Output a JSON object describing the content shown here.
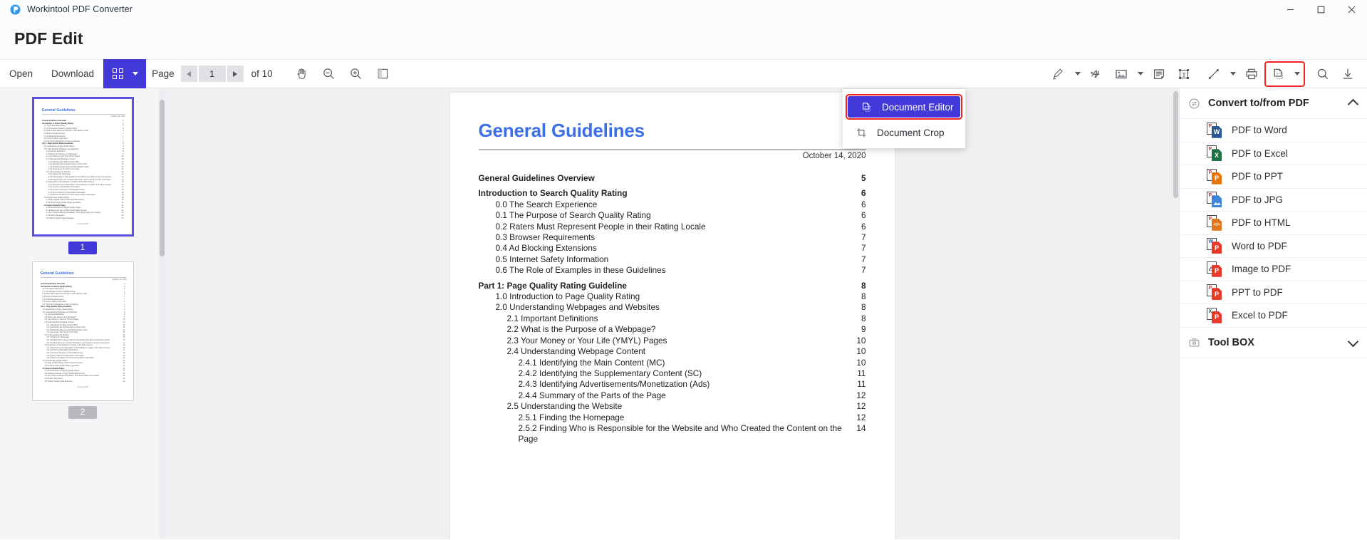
{
  "window": {
    "app_title": "Workintool PDF Converter",
    "logo_icon": "workintool-logo-icon",
    "minimize": "—",
    "maximize": "❐",
    "close": "✕"
  },
  "page_heading": {
    "title": "PDF Edit"
  },
  "toolbar": {
    "open_label": "Open",
    "download_label": "Download",
    "grid_view_icon": "grid-view-icon",
    "page_label": "Page",
    "page_value": "1",
    "page_total": "of 10",
    "prev_page_icon": "chevron-left-icon",
    "next_page_icon": "chevron-right-icon",
    "left_tools": [
      {
        "name": "hand-pan-icon",
        "title": "Pan"
      },
      {
        "name": "zoom-out-icon",
        "title": "Zoom out"
      },
      {
        "name": "zoom-in-icon",
        "title": "Zoom in"
      },
      {
        "name": "page-fit-icon",
        "title": "Page fit"
      }
    ],
    "right_tools": [
      {
        "name": "highlighter-icon",
        "title": "Highlight",
        "caret": true
      },
      {
        "name": "signature-icon",
        "title": "Signature",
        "caret": false
      },
      {
        "name": "insert-image-icon",
        "title": "Insert image",
        "caret": true
      },
      {
        "name": "sticky-note-icon",
        "title": "Note",
        "caret": false
      },
      {
        "name": "text-box-icon",
        "title": "Text box",
        "caret": false
      },
      {
        "name": "line-shape-icon",
        "title": "Line",
        "caret": true
      },
      {
        "name": "print-icon",
        "title": "Print",
        "caret": false
      },
      {
        "name": "document-editor-icon",
        "title": "Document Editor",
        "caret": true,
        "highlighted": true
      },
      {
        "name": "search-icon",
        "title": "Search",
        "caret": false
      },
      {
        "name": "download-icon",
        "title": "Download",
        "caret": false
      }
    ]
  },
  "dropdown": {
    "items": [
      {
        "label": "Document Editor",
        "icon": "document-editor-icon",
        "active": true
      },
      {
        "label": "Document Crop",
        "icon": "document-crop-icon",
        "active": false
      }
    ]
  },
  "thumbnails": [
    {
      "page_number": "1",
      "selected": true
    },
    {
      "page_number": "2",
      "selected": false
    }
  ],
  "right_panel": {
    "sections": [
      {
        "title": "Convert to/from PDF",
        "icon": "convert-circular-icon",
        "expanded": true,
        "chevron": "chevron-up-icon",
        "items": [
          {
            "label": "PDF to Word",
            "from": "P",
            "to": "W",
            "color": "#2b5797"
          },
          {
            "label": "PDF to Excel",
            "from": "P",
            "to": "X",
            "color": "#1e7145"
          },
          {
            "label": "PDF to PPT",
            "from": "P",
            "to": "P",
            "color": "#e8750a"
          },
          {
            "label": "PDF to JPG",
            "from": "P",
            "to": "",
            "color": "#3b84d9"
          },
          {
            "label": "PDF to HTML",
            "from": "P",
            "to": "</>",
            "color": "#e0751a"
          },
          {
            "label": "Word to PDF",
            "from": "W",
            "to": "P",
            "color": "#e8392b"
          },
          {
            "label": "Image to PDF",
            "from": "",
            "to": "P",
            "color": "#e8392b"
          },
          {
            "label": "PPT to PDF",
            "from": "P",
            "to": "P",
            "color": "#e8392b"
          },
          {
            "label": "Excel to PDF",
            "from": "X",
            "to": "P",
            "color": "#e8392b"
          }
        ]
      },
      {
        "title": "Tool BOX",
        "icon": "toolbox-icon",
        "expanded": false,
        "chevron": "chevron-down-icon",
        "items": []
      }
    ]
  },
  "document": {
    "heading": "General Guidelines",
    "date": "October 14, 2020",
    "toc": [
      {
        "text": "General Guidelines Overview",
        "page": "5",
        "bold": true,
        "indent": 0
      },
      {
        "text": "Introduction to Search Quality Rating",
        "page": "6",
        "bold": true,
        "indent": 0
      },
      {
        "text": "0.0 The Search Experience",
        "page": "6",
        "bold": false,
        "indent": 1
      },
      {
        "text": "0.1 The Purpose of Search Quality Rating",
        "page": "6",
        "bold": false,
        "indent": 1
      },
      {
        "text": "0.2 Raters Must Represent People in their Rating Locale",
        "page": "6",
        "bold": false,
        "indent": 1
      },
      {
        "text": "0.3 Browser Requirements",
        "page": "7",
        "bold": false,
        "indent": 1
      },
      {
        "text": "0.4 Ad Blocking Extensions",
        "page": "7",
        "bold": false,
        "indent": 1
      },
      {
        "text": "0.5 Internet Safety Information",
        "page": "7",
        "bold": false,
        "indent": 1
      },
      {
        "text": "0.6 The Role of Examples in these Guidelines",
        "page": "7",
        "bold": false,
        "indent": 1
      },
      {
        "text": "Part 1: Page Quality Rating Guideline",
        "page": "8",
        "bold": true,
        "indent": 0
      },
      {
        "text": "1.0 Introduction to Page Quality Rating",
        "page": "8",
        "bold": false,
        "indent": 1
      },
      {
        "text": "2.0 Understanding Webpages and Websites",
        "page": "8",
        "bold": false,
        "indent": 1
      },
      {
        "text": "2.1 Important Definitions",
        "page": "8",
        "bold": false,
        "indent": 2
      },
      {
        "text": "2.2 What is the Purpose of a Webpage?",
        "page": "9",
        "bold": false,
        "indent": 2
      },
      {
        "text": "2.3 Your Money or Your Life (YMYL) Pages",
        "page": "10",
        "bold": false,
        "indent": 2
      },
      {
        "text": "2.4 Understanding Webpage Content",
        "page": "10",
        "bold": false,
        "indent": 2
      },
      {
        "text": "2.4.1 Identifying the Main Content (MC)",
        "page": "10",
        "bold": false,
        "indent": 3
      },
      {
        "text": "2.4.2 Identifying the Supplementary Content (SC)",
        "page": "11",
        "bold": false,
        "indent": 3
      },
      {
        "text": "2.4.3 Identifying Advertisements/Monetization (Ads)",
        "page": "11",
        "bold": false,
        "indent": 3
      },
      {
        "text": "2.4.4 Summary of the Parts of the Page",
        "page": "12",
        "bold": false,
        "indent": 3
      },
      {
        "text": "2.5 Understanding the Website",
        "page": "12",
        "bold": false,
        "indent": 2
      },
      {
        "text": "2.5.1 Finding the Homepage",
        "page": "12",
        "bold": false,
        "indent": 3
      },
      {
        "text": "2.5.2 Finding Who is Responsible for the Website and Who Created the Content on the Page",
        "page": "14",
        "bold": false,
        "indent": 3
      }
    ],
    "thumb_toc_rows": [
      {
        "t": "General Guidelines Overview",
        "n": "5",
        "b": true,
        "i": 0
      },
      {
        "t": "Introduction to Search Quality Rating",
        "n": "6",
        "b": true,
        "i": 0
      },
      {
        "t": "0.0 The Search Experience",
        "n": "6",
        "b": false,
        "i": 1
      },
      {
        "t": "0.1 The Purpose of Search Quality Rating",
        "n": "6",
        "b": false,
        "i": 1
      },
      {
        "t": "0.2 Raters Must Represent People in their Rating Locale",
        "n": "6",
        "b": false,
        "i": 1
      },
      {
        "t": "0.3 Browser Requirements",
        "n": "7",
        "b": false,
        "i": 1
      },
      {
        "t": "0.4 Ad Blocking Extensions",
        "n": "7",
        "b": false,
        "i": 1
      },
      {
        "t": "0.5 Internet Safety Information",
        "n": "7",
        "b": false,
        "i": 1
      },
      {
        "t": "0.6 The Role of Examples in these Guidelines",
        "n": "7",
        "b": false,
        "i": 1
      },
      {
        "t": "Part 1: Page Quality Rating Guideline",
        "n": "8",
        "b": true,
        "i": 0
      },
      {
        "t": "1.0 Introduction to Page Quality Rating",
        "n": "8",
        "b": false,
        "i": 1
      },
      {
        "t": "2.0 Understanding Webpages and Websites",
        "n": "8",
        "b": false,
        "i": 1
      },
      {
        "t": "2.1 Important Definitions",
        "n": "8",
        "b": false,
        "i": 2
      },
      {
        "t": "2.2 What is the Purpose of a Webpage?",
        "n": "9",
        "b": false,
        "i": 2
      },
      {
        "t": "2.3 Your Money or Your Life (YMYL) Pages",
        "n": "10",
        "b": false,
        "i": 2
      },
      {
        "t": "2.4 Understanding Webpage Content",
        "n": "10",
        "b": false,
        "i": 2
      },
      {
        "t": "2.4.1 Identifying the Main Content (MC)",
        "n": "10",
        "b": false,
        "i": 3
      },
      {
        "t": "2.4.2 Identifying the Supplementary Content (SC)",
        "n": "11",
        "b": false,
        "i": 3
      },
      {
        "t": "2.4.3 Identifying Advertisements/Monetization (Ads)",
        "n": "11",
        "b": false,
        "i": 3
      },
      {
        "t": "2.4.4 Summary of the Parts of the Page",
        "n": "12",
        "b": false,
        "i": 3
      },
      {
        "t": "2.5 Understanding the Website",
        "n": "12",
        "b": false,
        "i": 2
      },
      {
        "t": "2.5.1 Finding the Homepage",
        "n": "12",
        "b": false,
        "i": 3
      },
      {
        "t": "2.5.2 Finding Who is Responsible for the Website and Who Created the Content",
        "n": "14",
        "b": false,
        "i": 3
      },
      {
        "t": "2.5.3 Finding About Us, Contact Information, and Customer Service Information",
        "n": "14",
        "b": false,
        "i": 3
      },
      {
        "t": "2.6 Reputation of the Website or Creator of the Main Content",
        "n": "15",
        "b": false,
        "i": 2
      },
      {
        "t": "2.6.1 Research on the Reputation of the Website or Creator of the Main Content",
        "n": "16",
        "b": false,
        "i": 3
      },
      {
        "t": "2.6.2 Sources of Reputation Information",
        "n": "17",
        "b": false,
        "i": 3
      },
      {
        "t": "2.6.3 Customer Reviews of Stores/Businesses",
        "n": "18",
        "b": false,
        "i": 3
      },
      {
        "t": "2.6.4 How to Search for Reputation Information",
        "n": "18",
        "b": false,
        "i": 3
      },
      {
        "t": "2.6.5 What to Do When You Find No Reputation Information",
        "n": "20",
        "b": false,
        "i": 3
      },
      {
        "t": "3.0 Overall Page Quality Rating",
        "n": "20",
        "b": false,
        "i": 1
      },
      {
        "t": "3.1 Page Quality Rating: Most Important Factors",
        "n": "20",
        "b": false,
        "i": 2
      },
      {
        "t": "3.2 Example Page Quality Rating Questions",
        "n": "21",
        "b": false,
        "i": 2
      },
      {
        "t": "4.0 Highest Quality Pages",
        "n": "21",
        "b": true,
        "i": 1
      },
      {
        "t": "4.1 Characteristics of Highest Quality Pages",
        "n": "21",
        "b": false,
        "i": 2
      },
      {
        "t": "4.2 Satisfying Amount of High Quality Main Content",
        "n": "22",
        "b": false,
        "i": 2
      },
      {
        "t": "4.3 Very Positive Website Reputation, Who Responsible and Created",
        "n": "22",
        "b": false,
        "i": 2
      },
      {
        "t": "4.4 Positive Reputation",
        "n": "23",
        "b": false,
        "i": 2
      },
      {
        "t": "4.5 Highest Quality Page Examples",
        "n": "23",
        "b": false,
        "i": 2
      }
    ],
    "thumb_footer": "Copyright 2020"
  }
}
